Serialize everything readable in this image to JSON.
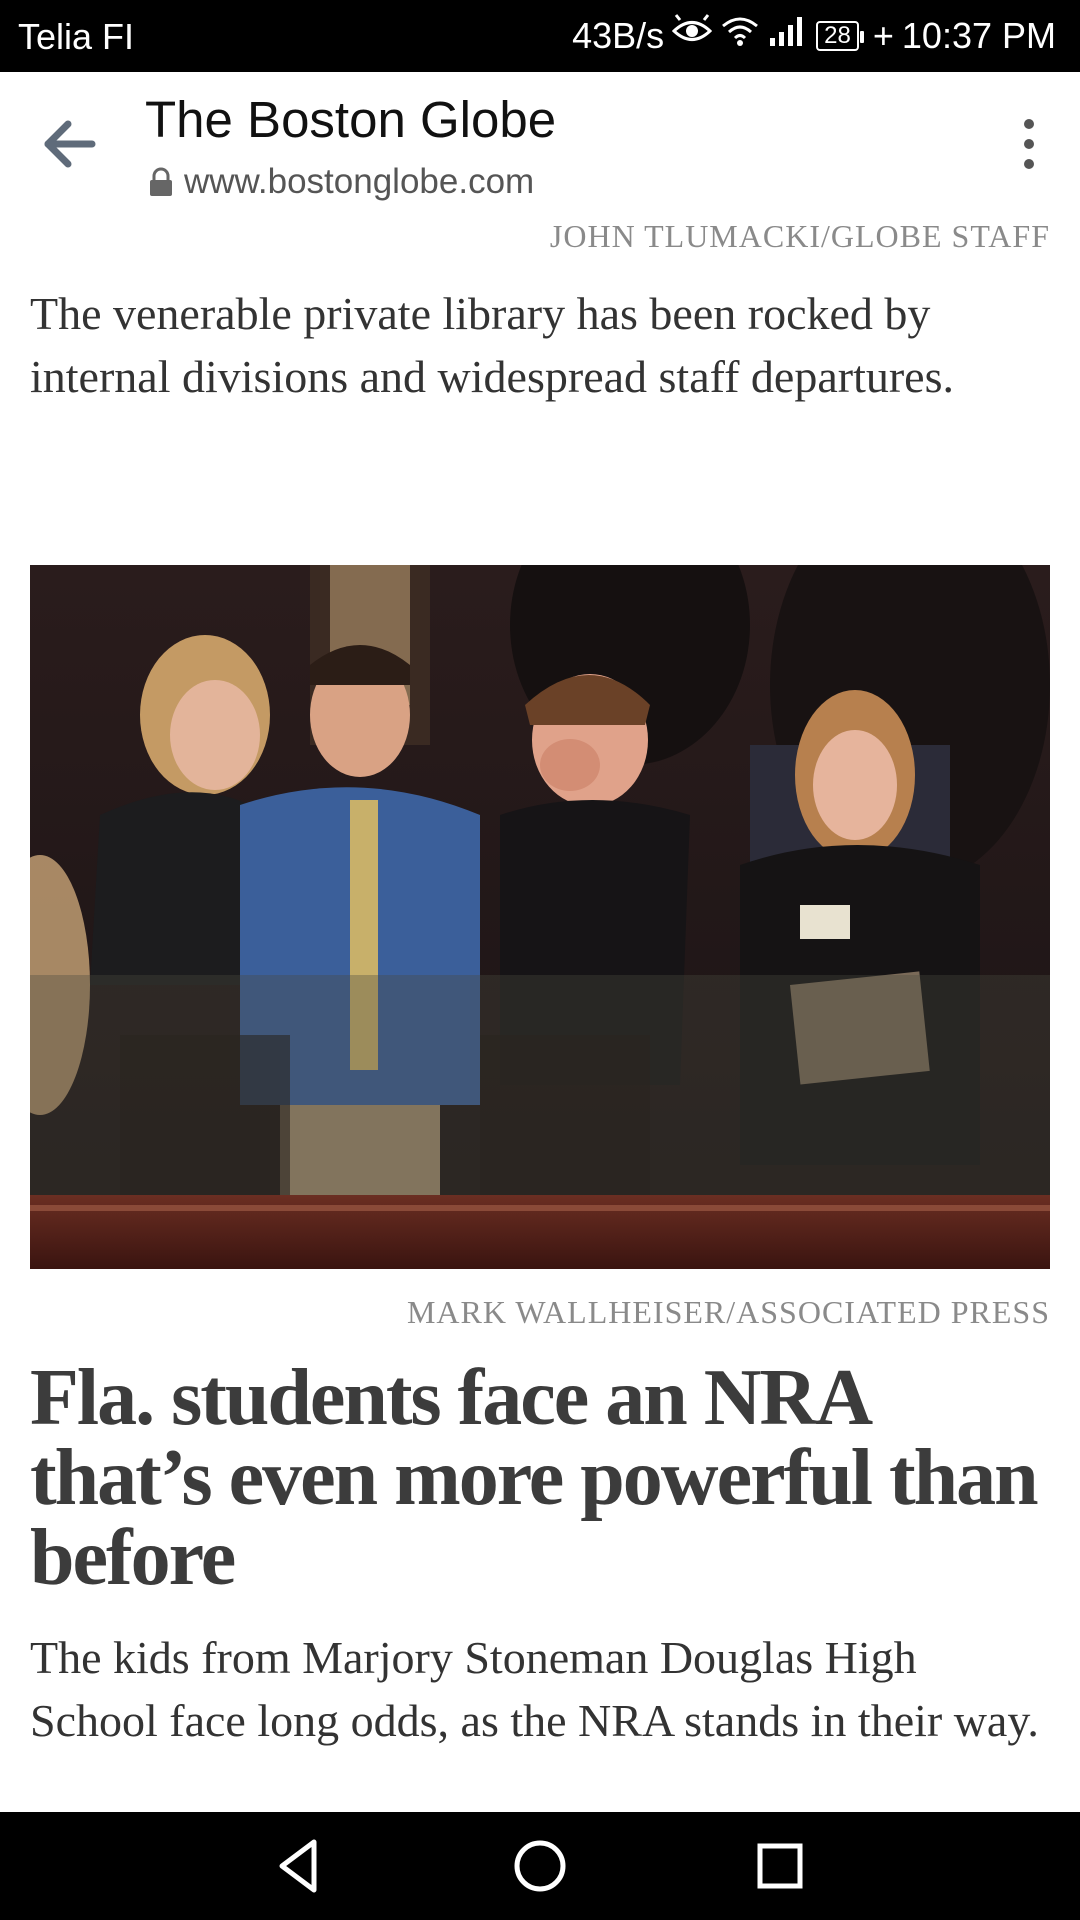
{
  "status_bar": {
    "carrier": "Telia FI",
    "data_speed": "43B/s",
    "battery": "28",
    "time": "10:37 PM"
  },
  "header": {
    "title": "The Boston Globe",
    "url": "www.bostonglobe.com"
  },
  "article_prev": {
    "photo_credit": "JOHN TLUMACKI/GLOBE STAFF",
    "summary": "The venerable private library has been rocked by internal divisions and widespread staff departures."
  },
  "article": {
    "photo_credit": "MARK WALLHEISER/ASSOCIATED PRESS",
    "headline": "Fla. students face an NRA that’s even more powerful than before",
    "summary": "The kids from Marjory Stoneman Douglas High School face long odds, as the NRA stands in their way."
  },
  "icons": {
    "back": "arrow-left-icon",
    "menu": "more-vert-icon",
    "lock": "lock-icon",
    "nav_back": "triangle-back-icon",
    "nav_home": "circle-home-icon",
    "nav_recent": "square-recent-icon"
  },
  "colors": {
    "header_text": "#111111",
    "credit_text": "#8a8a8a",
    "body_text": "#333333",
    "headline_text": "#3c3c3c",
    "back_arrow": "#5f6b7a"
  }
}
